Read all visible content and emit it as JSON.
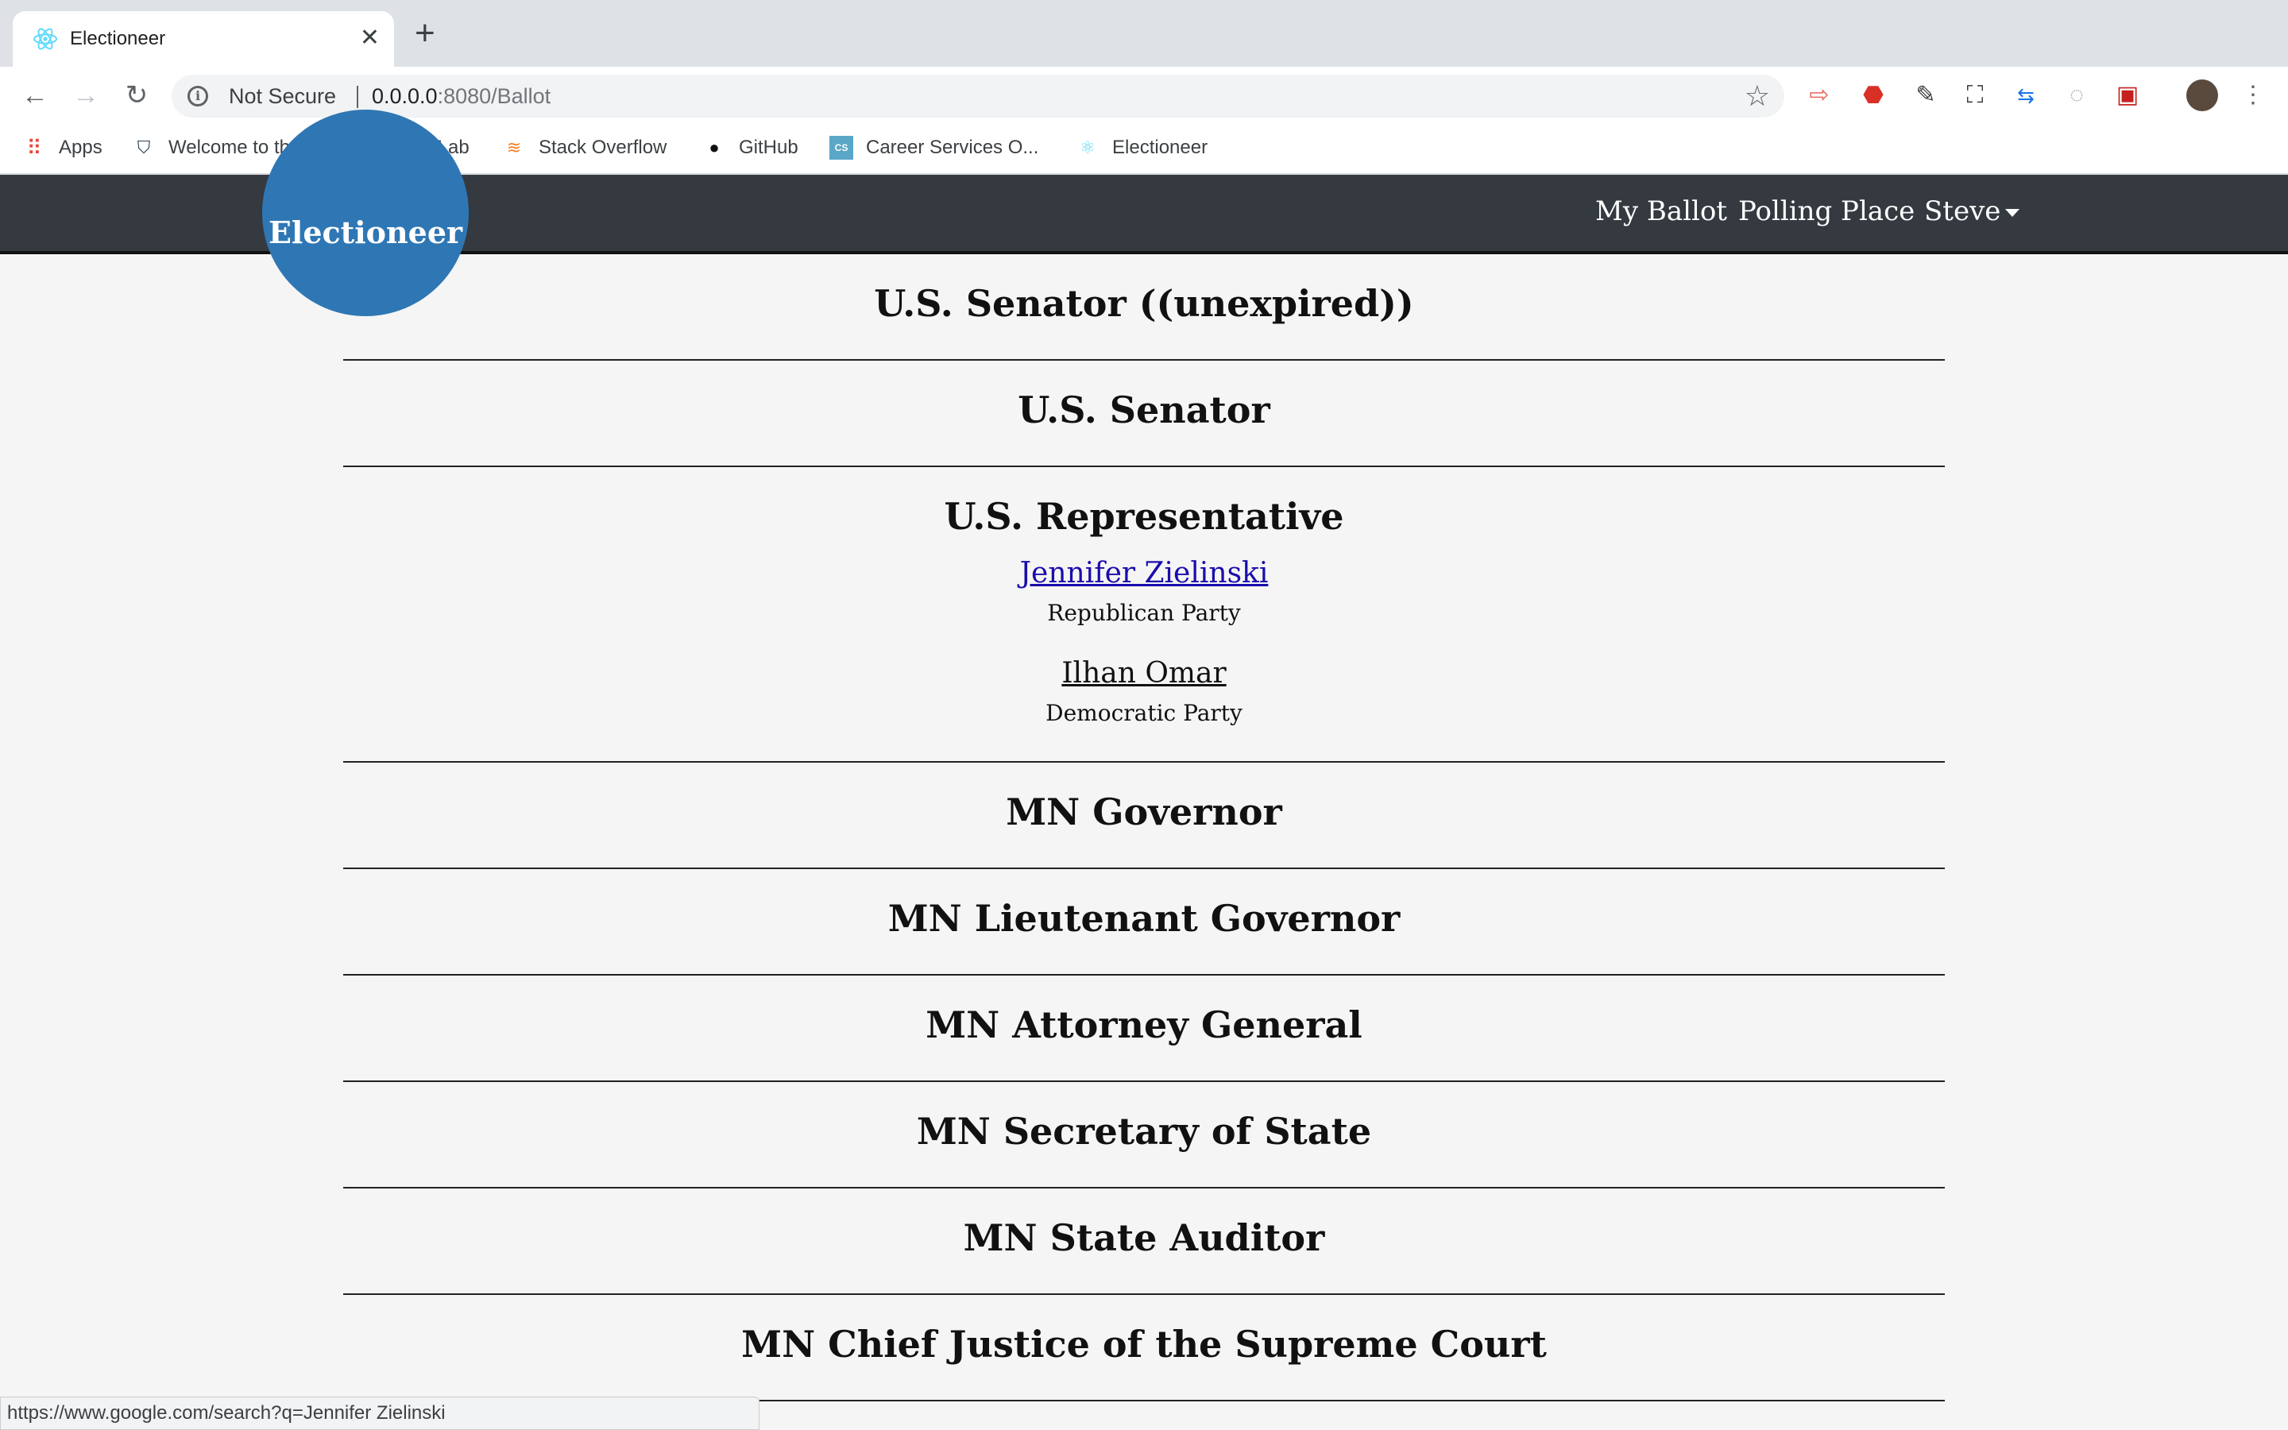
{
  "browser": {
    "tab_title": "Electioneer",
    "security_label": "Not Secure",
    "url_host": "0.0.0.0",
    "url_rest": ":8080/Ballot",
    "bookmarks": [
      {
        "label": "Apps",
        "icon": "apps-grid-icon"
      },
      {
        "label": "Welcome to the N...",
        "icon": "shield-bookmark-icon"
      },
      {
        "label": "GitLab",
        "icon": "gitlab-icon"
      },
      {
        "label": "Stack Overflow",
        "icon": "stackoverflow-icon"
      },
      {
        "label": "GitHub",
        "icon": "github-icon"
      },
      {
        "label": "Career Services O...",
        "icon": "cs-icon"
      },
      {
        "label": "Electioneer",
        "icon": "react-icon"
      }
    ],
    "status_url": "https://www.google.com/search?q=Jennifer Zielinski"
  },
  "app": {
    "brand": "Electioneer",
    "nav": {
      "my_ballot": "My Ballot",
      "polling_place": "Polling Place",
      "user": "Steve"
    }
  },
  "races": [
    {
      "title": "U.S. Senator ((unexpired))",
      "candidates": []
    },
    {
      "title": "U.S. Senator",
      "candidates": []
    },
    {
      "title": "U.S. Representative",
      "candidates": [
        {
          "name": "Jennifer Zielinski",
          "party": "Republican Party",
          "hovered": true
        },
        {
          "name": "Ilhan Omar",
          "party": "Democratic Party",
          "hovered": false
        }
      ]
    },
    {
      "title": "MN Governor",
      "candidates": []
    },
    {
      "title": "MN Lieutenant Governor",
      "candidates": []
    },
    {
      "title": "MN Attorney General",
      "candidates": []
    },
    {
      "title": "MN Secretary of State",
      "candidates": []
    },
    {
      "title": "MN State Auditor",
      "candidates": []
    },
    {
      "title": "MN Chief Justice of the Supreme Court",
      "candidates": []
    }
  ]
}
